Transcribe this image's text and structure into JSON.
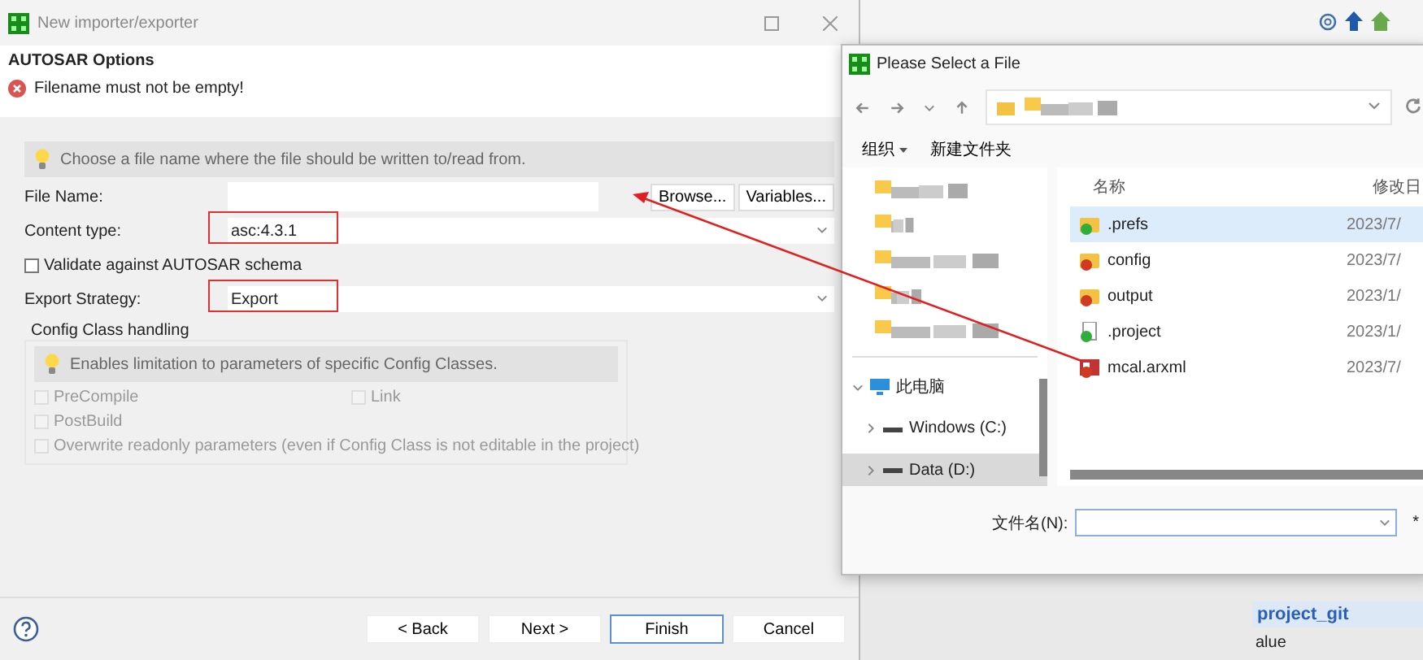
{
  "background_app": {
    "tree_item": "project_git",
    "cell": "alue"
  },
  "wizard": {
    "title": "New importer/exporter",
    "page_title": "AUTOSAR Options",
    "error": "Filename must not be empty!",
    "hint": "Choose a file name where the file should be written to/read from.",
    "fields": [
      {
        "kind": "file",
        "label": "File Name:",
        "buttons": [
          "Browse...",
          "Variables..."
        ]
      },
      {
        "kind": "combo",
        "label": "Content type:",
        "value": "asc:4.3.1",
        "highlighted": true
      },
      {
        "kind": "checkbox",
        "label": "Validate against AUTOSAR schema",
        "checked": false
      },
      {
        "kind": "combo",
        "label": "Export Strategy:",
        "value": "Export",
        "highlighted": true
      }
    ],
    "config_group": {
      "title": "Config Class handling",
      "hint": "Enables limitation to parameters of specific Config Classes.",
      "option_rows": [
        [
          {
            "label": "PreCompile",
            "checked": false,
            "disabled": true
          },
          {
            "label": "Link",
            "checked": false,
            "disabled": true
          }
        ],
        [
          {
            "label": "PostBuild",
            "checked": false,
            "disabled": true
          }
        ],
        [
          {
            "label": "Overwrite readonly parameters (even if Config Class is not editable in the project)",
            "checked": false,
            "disabled": true
          }
        ]
      ]
    },
    "buttons": [
      {
        "label": "< Back",
        "default": false
      },
      {
        "label": "Next >",
        "default": false
      },
      {
        "label": "Finish",
        "default": true
      },
      {
        "label": "Cancel",
        "default": false
      }
    ]
  },
  "file_dialog": {
    "title": "Please Select a File",
    "toolbar": [
      "组织",
      "新建文件夹"
    ],
    "tree": [
      {
        "label": "此电脑",
        "expanded": true,
        "children": [
          {
            "label": "Windows (C:)",
            "selected": false
          },
          {
            "label": "Data (D:)",
            "selected": true
          }
        ]
      }
    ],
    "columns": [
      "名称",
      "修改日"
    ],
    "files": [
      {
        "name": ".prefs",
        "date": "2023/7/",
        "kind": "folder",
        "color": "#2fae3a",
        "selected": true
      },
      {
        "name": "config",
        "date": "2023/7/",
        "kind": "folder",
        "color": "#d03a20",
        "selected": false
      },
      {
        "name": "output",
        "date": "2023/1/",
        "kind": "folder",
        "color": "#d03a20",
        "selected": false
      },
      {
        "name": ".project",
        "date": "2023/1/",
        "kind": "file",
        "color": "#2fae3a",
        "selected": false
      },
      {
        "name": "mcal.arxml",
        "date": "2023/7/",
        "kind": "model",
        "color": "#d03a20",
        "selected": false
      }
    ],
    "filename_label": "文件名(N):",
    "filter_text": "*"
  }
}
